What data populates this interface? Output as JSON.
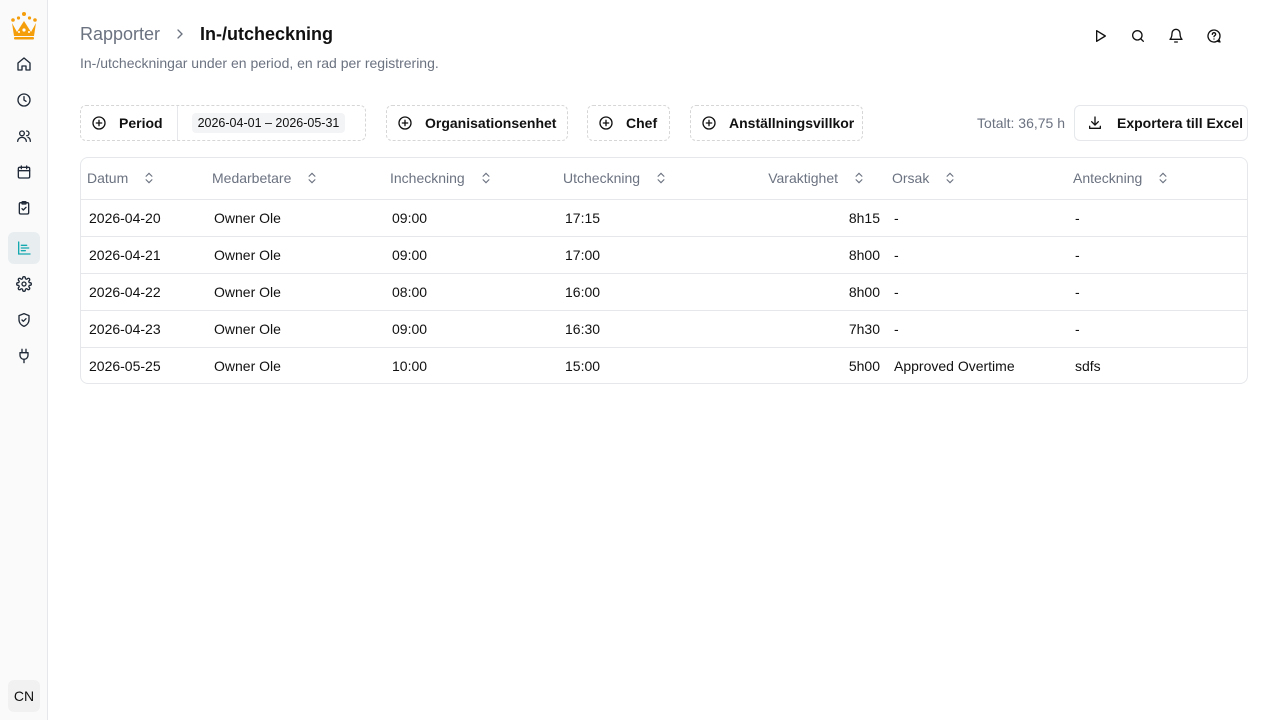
{
  "sidebar": {
    "logo": "crown-logo",
    "items": [
      {
        "name": "home-icon"
      },
      {
        "name": "clock-icon"
      },
      {
        "name": "users-icon"
      },
      {
        "name": "calendar-icon"
      },
      {
        "name": "clipboard-check-icon"
      },
      {
        "name": "reports-icon",
        "active": true
      },
      {
        "name": "gear-icon"
      },
      {
        "name": "shield-check-icon"
      },
      {
        "name": "plug-icon"
      }
    ],
    "avatar": "CN"
  },
  "header": {
    "breadcrumb_parent": "Rapporter",
    "breadcrumb_current": "In-/utcheckning",
    "subtitle": "In-/utcheckningar under en period, en rad per registrering."
  },
  "filters": {
    "period_label": "Period",
    "period_value": "2026-04-01 – 2026-05-31",
    "org_label": "Organisationsenhet",
    "manager_label": "Chef",
    "terms_label": "Anställningsvillkor"
  },
  "summary": {
    "total": "Totalt: 36,75 h",
    "export_label": "Exportera till Excel"
  },
  "table": {
    "columns": [
      "Datum",
      "Medarbetare",
      "Incheckning",
      "Utcheckning",
      "Varaktighet",
      "Orsak",
      "Anteckning"
    ],
    "rows": [
      [
        "2026-04-20",
        "Owner Ole",
        "09:00",
        "17:15",
        "8h15",
        "-",
        "-"
      ],
      [
        "2026-04-21",
        "Owner Ole",
        "09:00",
        "17:00",
        "8h00",
        "-",
        "-"
      ],
      [
        "2026-04-22",
        "Owner Ole",
        "08:00",
        "16:00",
        "8h00",
        "-",
        "-"
      ],
      [
        "2026-04-23",
        "Owner Ole",
        "09:00",
        "16:30",
        "7h30",
        "-",
        "-"
      ],
      [
        "2026-05-25",
        "Owner Ole",
        "10:00",
        "15:00",
        "5h00",
        "Approved Overtime",
        "sdfs"
      ]
    ]
  },
  "colors": {
    "accent": "#14a9b0",
    "logo": "#f59e0b"
  }
}
